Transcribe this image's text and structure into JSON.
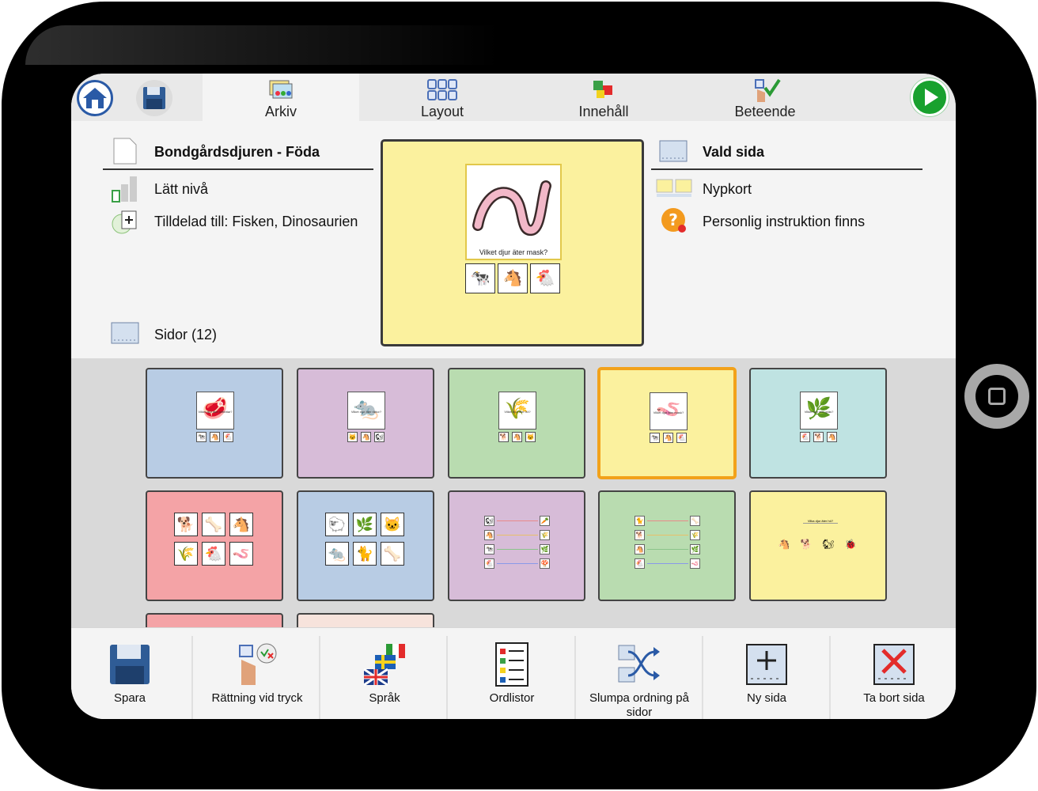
{
  "toolbar": {
    "tabs": [
      {
        "label": "Arkiv",
        "icon": "folder-cards-icon"
      },
      {
        "label": "Layout",
        "icon": "grid-layout-icon"
      },
      {
        "label": "Innehåll",
        "icon": "content-blocks-icon"
      },
      {
        "label": "Beteende",
        "icon": "touch-check-icon"
      }
    ],
    "active_tab": "Arkiv"
  },
  "file_info": {
    "name": "Bondgårdsdjuren - Föda",
    "level": "Lätt nivå",
    "assigned": "Tilldelad till: Fisken, Dinosaurien",
    "pages": "Sidor (12)"
  },
  "preview": {
    "question": "Vilket djur äter mask?",
    "answers": [
      "🐄",
      "🐴",
      "🐔"
    ],
    "color": "#fbf19e"
  },
  "selected_page": {
    "title": "Vald sida",
    "type": "Nypkort",
    "instruction": "Personlig instruktion finns"
  },
  "thumbnails": [
    {
      "color": "#b8cce4",
      "kind": "quiz",
      "main": "🥩",
      "question": "Vilket djur äter köttbitar?",
      "answers": [
        "🐄",
        "🐴",
        "🐔"
      ]
    },
    {
      "color": "#d7bcd8",
      "kind": "quiz",
      "main": "🐀",
      "question": "Vilket djur äter råttor?",
      "answers": [
        "🐱",
        "🐴",
        "🐿"
      ]
    },
    {
      "color": "#b9dcb0",
      "kind": "quiz",
      "main": "🌾",
      "question": "Vilket djur äter hö?",
      "answers": [
        "🐕",
        "🐴",
        "🐱"
      ]
    },
    {
      "color": "#fbf19e",
      "kind": "quiz",
      "main": "🪱",
      "question": "Vilket djur äter mask?",
      "answers": [
        "🐄",
        "🐴",
        "🐔"
      ],
      "selected": true
    },
    {
      "color": "#bfe3e2",
      "kind": "quiz",
      "main": "🌿",
      "question": "Vilket djur äter gräs?",
      "answers": [
        "🐔",
        "🐕",
        "🐴"
      ]
    },
    {
      "color": "#f4a3a6",
      "kind": "grid",
      "cells": [
        "🐕",
        "🦴",
        "🐴",
        "🌾",
        "🐔",
        "🪱"
      ]
    },
    {
      "color": "#b8cce4",
      "kind": "grid",
      "cells": [
        "🐑",
        "🌿",
        "🐱",
        "🐀",
        "🐈",
        "🦴"
      ]
    },
    {
      "color": "#d7bcd8",
      "kind": "match",
      "left": [
        "🐿",
        "🐴",
        "🐄",
        "🐔"
      ],
      "right": [
        "🥕",
        "🌾",
        "🌿",
        "🍄"
      ]
    },
    {
      "color": "#b9dcb0",
      "kind": "match",
      "left": [
        "🐈",
        "🐕",
        "🐴",
        "🐔"
      ],
      "right": [
        "🦴",
        "🌾",
        "🌿",
        "🪱"
      ]
    },
    {
      "color": "#fbf19e",
      "kind": "row",
      "title": "Vilka djur äter hö?",
      "items": [
        "🐴",
        "🐕",
        "🐿",
        "🐞"
      ]
    }
  ],
  "partial_thumbnails": [
    "#f4a3a6",
    "#f7e3dc"
  ],
  "bottom_bar": [
    {
      "label": "Spara",
      "icon": "floppy-disk-icon"
    },
    {
      "label": "Rättning vid tryck",
      "icon": "touch-correction-icon"
    },
    {
      "label": "Språk",
      "icon": "language-flags-icon"
    },
    {
      "label": "Ordlistor",
      "icon": "word-list-icon"
    },
    {
      "label": "Slumpa ordning på sidor",
      "icon": "shuffle-pages-icon"
    },
    {
      "label": "Ny sida",
      "icon": "new-page-icon"
    },
    {
      "label": "Ta bort sida",
      "icon": "delete-page-icon"
    }
  ],
  "colors": {
    "accent_blue": "#2a5aa6",
    "play_green": "#18a12e",
    "selection_orange": "#f2a21a"
  }
}
